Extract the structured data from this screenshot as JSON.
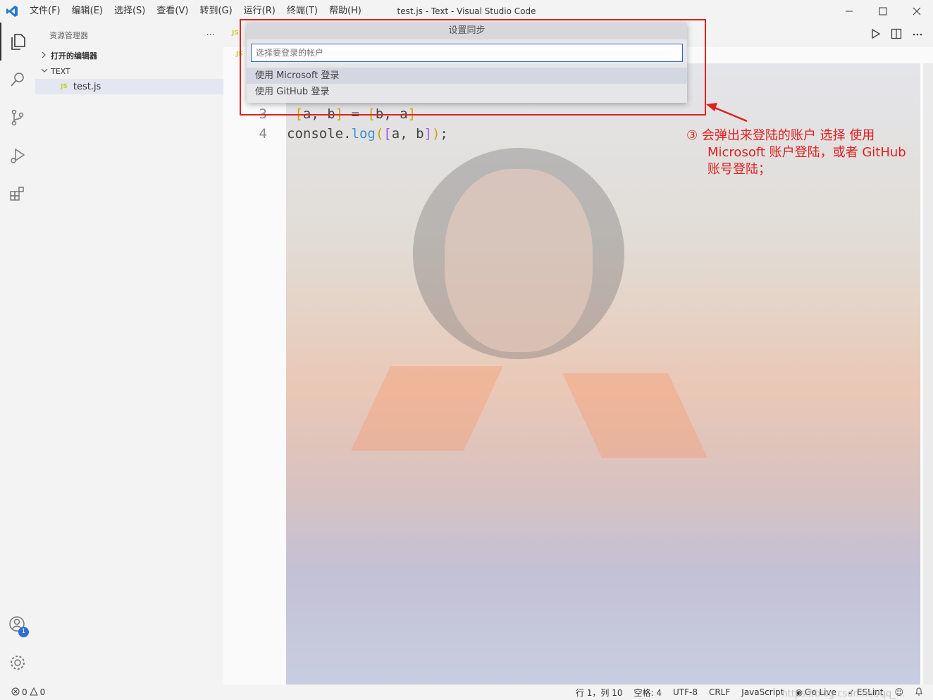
{
  "window": {
    "title": "test.js - Text - Visual Studio Code",
    "menu": [
      "文件(F)",
      "编辑(E)",
      "选择(S)",
      "查看(V)",
      "转到(G)",
      "运行(R)",
      "终端(T)",
      "帮助(H)"
    ]
  },
  "sidebar": {
    "title": "资源管理器",
    "more": "···",
    "open_editors": "打开的编辑器",
    "folder": "TEXT",
    "file": "test.js",
    "file_icon": "JS"
  },
  "activity": {
    "badge": "1"
  },
  "editor": {
    "tab_icon": "JS",
    "breadcrumb_icon": "JS",
    "lines": [
      {
        "num": "3",
        "segments": [
          {
            "t": " ",
            "c": ""
          },
          {
            "t": "[",
            "c": "k-b"
          },
          {
            "t": "a, b",
            "c": ""
          },
          {
            "t": "]",
            "c": "k-b"
          },
          {
            "t": " = ",
            "c": ""
          },
          {
            "t": "[",
            "c": "k-b"
          },
          {
            "t": "b, a",
            "c": ""
          },
          {
            "t": "]",
            "c": "k-b"
          }
        ]
      },
      {
        "num": "4",
        "segments": [
          {
            "t": "console.",
            "c": ""
          },
          {
            "t": "log",
            "c": "k-m"
          },
          {
            "t": "(",
            "c": "k-b"
          },
          {
            "t": "[",
            "c": "k-p"
          },
          {
            "t": "a, b",
            "c": ""
          },
          {
            "t": "]",
            "c": "k-p"
          },
          {
            "t": ")",
            "c": "k-b"
          },
          {
            "t": ";",
            "c": ""
          }
        ]
      }
    ]
  },
  "quickpick": {
    "title": "设置同步",
    "placeholder": "选择要登录的帐户",
    "items": [
      "使用 Microsoft 登录",
      "使用 GitHub 登录"
    ]
  },
  "annotation": {
    "text": "③ 会弹出来登陆的账户 选择 使用",
    "text2": "Microsoft 账户登陆，或者 GitHub",
    "text3": "账号登陆；"
  },
  "statusbar": {
    "errors": "0",
    "warnings": "0",
    "position": "行 1，列 10",
    "spaces": "空格: 4",
    "encoding": "UTF-8",
    "eol": "CRLF",
    "language": "JavaScript",
    "golive": "Go Live",
    "eslint": "ESLint"
  },
  "watermark": "https://blog.csdn.net/qq_..."
}
